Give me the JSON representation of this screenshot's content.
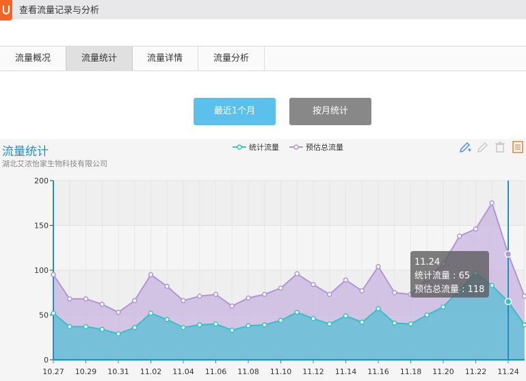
{
  "window": {
    "title": "查看流量记录与分析"
  },
  "tabs": [
    {
      "label": "流量概况"
    },
    {
      "label": "流量统计"
    },
    {
      "label": "流量详情"
    },
    {
      "label": "流量分析"
    }
  ],
  "buttons": {
    "recent_month": "最近1个月",
    "by_month": "按月统计"
  },
  "colors": {
    "accent": "#5bc0eb",
    "series_stat": "#36c0c4",
    "series_est": "#b095d6",
    "title": "#1a8fc9"
  },
  "chart_data": {
    "type": "area",
    "title": "流量统计",
    "subtitle": "湖北艾浓怡家生物科技有限公司",
    "xlabel": "",
    "ylabel": "",
    "ylim": [
      0,
      200
    ],
    "yticks": [
      0,
      50,
      100,
      150,
      200
    ],
    "grid": true,
    "legend_position": "top-center",
    "x": [
      "10.27",
      "10.28",
      "10.29",
      "10.30",
      "10.31",
      "11.01",
      "11.02",
      "11.03",
      "11.04",
      "11.05",
      "11.06",
      "11.07",
      "11.08",
      "11.09",
      "11.10",
      "11.11",
      "11.12",
      "11.13",
      "11.14",
      "11.15",
      "11.16",
      "11.17",
      "11.18",
      "11.19",
      "11.20",
      "11.21",
      "11.22",
      "11.23",
      "11.24",
      "11.25"
    ],
    "xtick_labels": [
      "10.27",
      "10.29",
      "10.31",
      "11.02",
      "11.04",
      "11.06",
      "11.08",
      "11.10",
      "11.12",
      "11.14",
      "11.16",
      "11.18",
      "11.20",
      "11.22",
      "11.24"
    ],
    "series": [
      {
        "name": "统计流量",
        "values": [
          52,
          37,
          37,
          34,
          29,
          36,
          52,
          45,
          36,
          39,
          40,
          33,
          38,
          39,
          44,
          53,
          46,
          40,
          49,
          42,
          57,
          41,
          40,
          50,
          59,
          78,
          97,
          83,
          65,
          39
        ]
      },
      {
        "name": "预估总流量",
        "values": [
          95,
          68,
          68,
          62,
          53,
          66,
          95,
          82,
          66,
          71,
          73,
          60,
          69,
          73,
          80,
          96,
          84,
          73,
          89,
          77,
          104,
          75,
          73,
          90,
          107,
          138,
          146,
          175,
          118,
          71
        ]
      }
    ],
    "tooltip": {
      "date": "11.24",
      "line1": "统计流量 : 65",
      "line2": "预估总流量 : 118"
    }
  }
}
